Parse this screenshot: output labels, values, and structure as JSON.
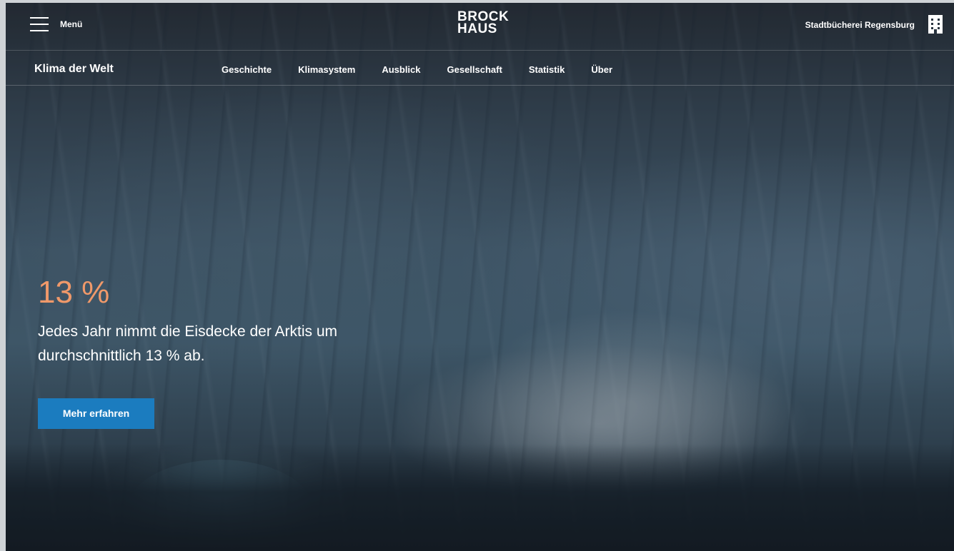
{
  "header": {
    "menu_label": "Menü",
    "logo_line1": "BROCK",
    "logo_line2": "HAUS",
    "library_name": "Stadtbücherei Regensburg"
  },
  "subnav": {
    "title": "Klima der Welt",
    "items": [
      "Geschichte",
      "Klimasystem",
      "Ausblick",
      "Gesellschaft",
      "Statistik",
      "Über"
    ]
  },
  "hero": {
    "stat": "13 %",
    "text": "Jedes Jahr nimmt die Eisdecke der Arktis um durchschnittlich 13 % ab.",
    "cta_label": "Mehr erfahren"
  },
  "colors": {
    "accent_orange": "#f0996a",
    "button_blue": "#1b7cbf"
  }
}
